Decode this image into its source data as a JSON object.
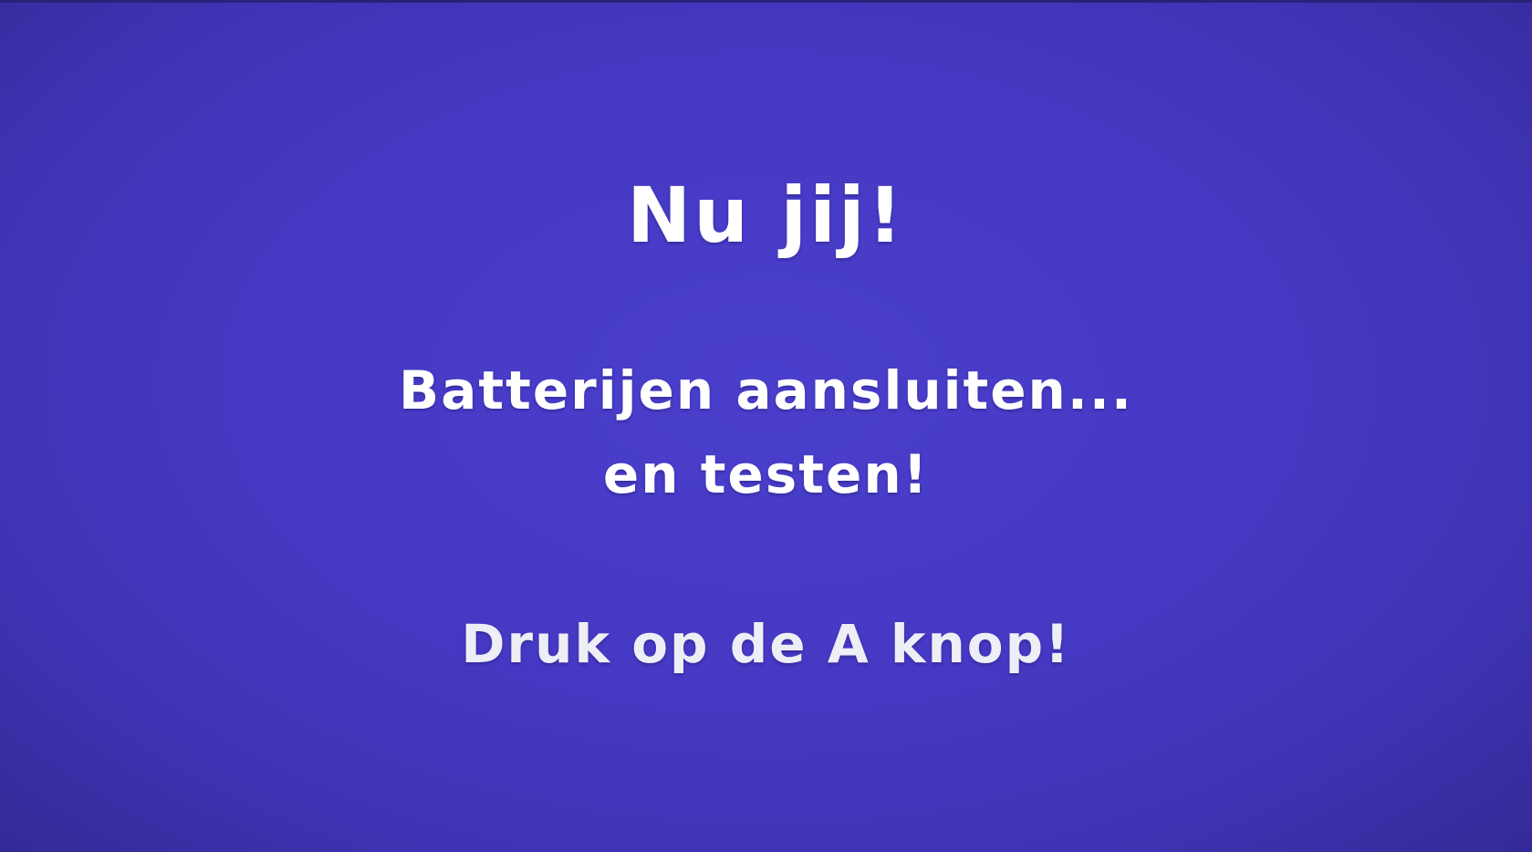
{
  "slide": {
    "title": "Nu jij!",
    "subtitle_line1": "Batterijen aansluiten...",
    "subtitle_line2": "en testen!",
    "call_to_action": "Druk op de A knop!"
  },
  "colors": {
    "background": "#4639c4",
    "text": "#ffffff",
    "call_to_action_text": "#eeeef6"
  }
}
